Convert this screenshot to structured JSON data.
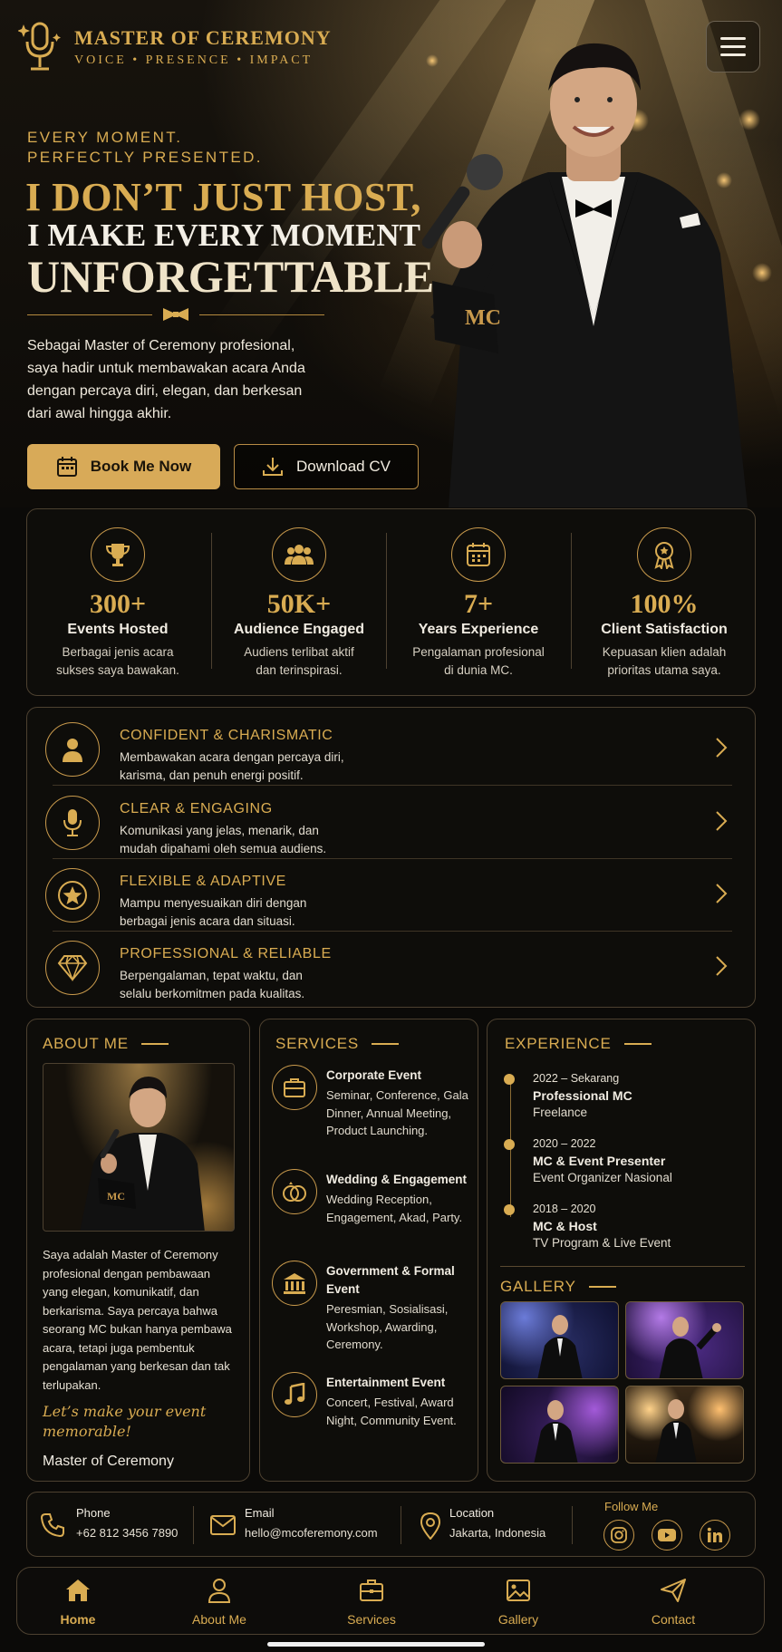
{
  "brand": {
    "title": "MASTER OF CEREMONY",
    "subtitle": "VOICE • PRESENCE • IMPACT"
  },
  "hero": {
    "tagline_1": "EVERY MOMENT.",
    "tagline_2": "PERFECTLY PRESENTED.",
    "headline_1": "I DON’T JUST HOST,",
    "headline_2": "I MAKE EVERY MOMENT",
    "headline_3": "UNFORGETTABLE",
    "intro": "Sebagai Master of Ceremony profesional, saya hadir untuk membawakan acara Anda dengan percaya diri, elegan, dan berkesan dari awal hingga akhir.",
    "mic_card_text": "MC",
    "book_label": "Book Me Now",
    "cv_label": "Download CV"
  },
  "stats": [
    {
      "value": "300+",
      "label": "Events Hosted",
      "desc_1": "Berbagai jenis acara",
      "desc_2": "sukses saya bawakan.",
      "icon": "trophy-icon"
    },
    {
      "value": "50K+",
      "label": "Audience Engaged",
      "desc_1": "Audiens terlibat aktif",
      "desc_2": "dan terinspirasi.",
      "icon": "audience-icon"
    },
    {
      "value": "7+",
      "label": "Years Experience",
      "desc_1": "Pengalaman profesional",
      "desc_2": "di dunia MC.",
      "icon": "calendar-icon"
    },
    {
      "value": "100%",
      "label": "Client Satisfaction",
      "desc_1": "Kepuasan klien adalah",
      "desc_2": "prioritas utama saya.",
      "icon": "award-icon"
    }
  ],
  "qualities": [
    {
      "title": "CONFIDENT & CHARISMATIC",
      "desc_1": "Membawakan acara dengan percaya diri,",
      "desc_2": "karisma, dan penuh energi positif.",
      "icon": "person-icon"
    },
    {
      "title": "CLEAR & ENGAGING",
      "desc_1": "Komunikasi yang jelas, menarik, dan",
      "desc_2": "mudah dipahami oleh semua audiens.",
      "icon": "microphone-icon"
    },
    {
      "title": "FLEXIBLE & ADAPTIVE",
      "desc_1": "Mampu menyesuaikan diri dengan",
      "desc_2": "berbagai jenis acara dan situasi.",
      "icon": "star-icon"
    },
    {
      "title": "PROFESSIONAL & RELIABLE",
      "desc_1": "Berpengalaman, tepat waktu, dan",
      "desc_2": "selalu berkomitmen pada kualitas.",
      "icon": "diamond-icon"
    }
  ],
  "about": {
    "heading": "ABOUT ME",
    "text": "Saya adalah Master of Ceremony profesional dengan pembawaan yang elegan, komunikatif, dan berkarisma. Saya percaya bahwa seorang MC bukan hanya pembawa acara, tetapi juga pembentuk pengalaman yang berkesan dan tak terlupakan.",
    "script_1": "Let’s make your event",
    "script_2": "memorable!",
    "signature": "Master of Ceremony"
  },
  "services": {
    "heading": "SERVICES",
    "items": [
      {
        "title": "Corporate Event",
        "desc": "Seminar, Conference, Gala Dinner, Annual Meeting, Product Launching.",
        "icon": "briefcase-icon"
      },
      {
        "title": "Wedding & Engagement",
        "desc": "Wedding Reception, Engagement, Akad, Party.",
        "icon": "rings-icon"
      },
      {
        "title": "Government & Formal Event",
        "desc": "Peresmian, Sosialisasi, Workshop, Awarding, Ceremony.",
        "icon": "building-icon"
      },
      {
        "title": "Entertainment Event",
        "desc": "Concert, Festival, Award Night, Community Event.",
        "icon": "music-note-icon"
      }
    ]
  },
  "experience": {
    "heading": "EXPERIENCE",
    "items": [
      {
        "years": "2022 – Sekarang",
        "role": "Professional MC",
        "org": "Freelance"
      },
      {
        "years": "2020 – 2022",
        "role": "MC & Event Presenter",
        "org": "Event Organizer Nasional"
      },
      {
        "years": "2018 – 2020",
        "role": "MC & Host",
        "org": "TV Program & Live Event"
      }
    ]
  },
  "gallery": {
    "heading": "GALLERY"
  },
  "contact": {
    "phone_label": "Phone",
    "phone_value": "+62 812 3456 7890",
    "email_label": "Email",
    "email_value": "hello@mcoferemony.com",
    "location_label": "Location",
    "location_value": "Jakarta, Indonesia",
    "follow_label": "Follow Me"
  },
  "nav": [
    {
      "label": "Home",
      "icon": "home-icon"
    },
    {
      "label": "About Me",
      "icon": "user-icon"
    },
    {
      "label": "Services",
      "icon": "briefcase-icon"
    },
    {
      "label": "Gallery",
      "icon": "image-icon"
    },
    {
      "label": "Contact",
      "icon": "send-icon"
    }
  ],
  "colors": {
    "accent": "#d9ac52",
    "background": "#0b0a08",
    "border": "#4d4130"
  }
}
